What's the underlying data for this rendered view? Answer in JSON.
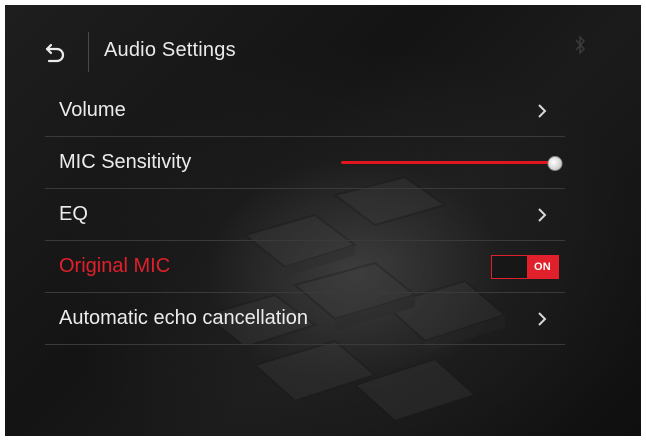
{
  "header": {
    "title": "Audio Settings",
    "back_icon": "back-arrow-icon",
    "bluetooth_icon": "bluetooth-icon"
  },
  "menu": {
    "items": [
      {
        "label": "Volume",
        "control": "chevron"
      },
      {
        "label": "MIC Sensitivity",
        "control": "slider",
        "value": 1.0
      },
      {
        "label": "EQ",
        "control": "chevron"
      },
      {
        "label": "Original MIC",
        "control": "toggle",
        "state": "ON",
        "active": true
      },
      {
        "label": "Automatic echo cancellation",
        "control": "chevron"
      }
    ]
  },
  "colors": {
    "accent": "#e0202a",
    "text": "#ececec",
    "background": "#141414",
    "divider": "#3a3a3a"
  }
}
